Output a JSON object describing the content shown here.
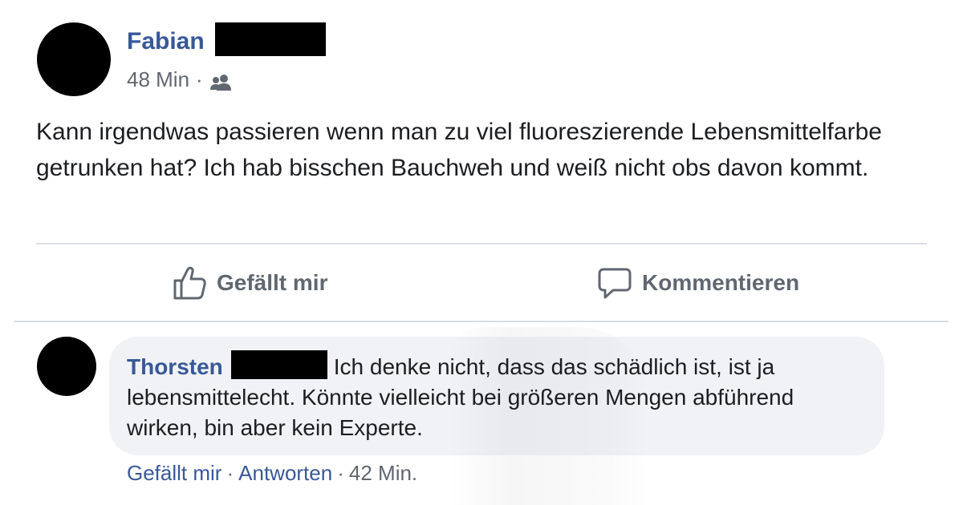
{
  "post": {
    "author_first_name": "Fabian",
    "timestamp": "48 Min",
    "separator": "·",
    "audience_icon": "friends-icon",
    "text": "Kann irgendwas passieren wenn man zu viel fluoreszierende Lebensmittelfarbe getrunken hat? Ich hab bisschen Bauchweh und weiß nicht obs davon kommt."
  },
  "actions": {
    "like_label": "Gefällt mir",
    "like_icon": "thumbs-up-icon",
    "comment_label": "Kommentieren",
    "comment_icon": "speech-bubble-icon"
  },
  "comment": {
    "author_first_name": "Thorsten",
    "text": "Ich denke nicht, dass das schädlich ist, ist ja lebensmittelecht. Könnte vielleicht bei größeren Mengen abführend wirken, bin aber kein Experte.",
    "like_label": "Gefällt mir",
    "reply_label": "Antworten",
    "separator": "·",
    "timestamp": "42 Min."
  },
  "colors": {
    "name_link": "#385898",
    "secondary_text": "#606770",
    "bubble_bg": "#f0f2f5",
    "divider": "#dadde1"
  }
}
